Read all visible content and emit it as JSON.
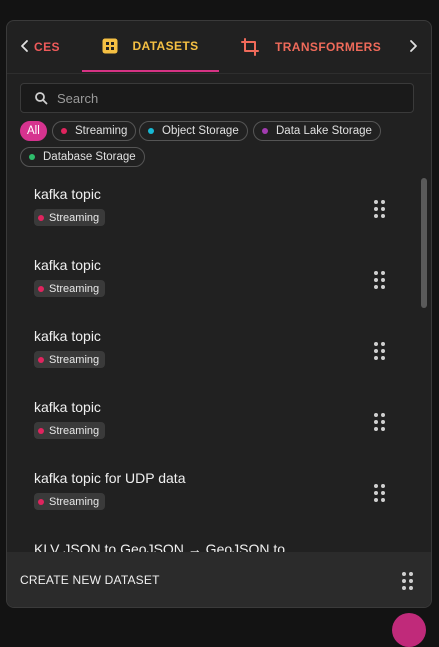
{
  "tabs": {
    "prev_label": "CES",
    "datasets_label": "DATASETS",
    "transformers_label": "TRANSFORMERS"
  },
  "search": {
    "placeholder": "Search"
  },
  "filters": [
    {
      "label": "All",
      "color": "#d6338f"
    },
    {
      "label": "Streaming",
      "color": "#e0245e"
    },
    {
      "label": "Object Storage",
      "color": "#17b8d4"
    },
    {
      "label": "Data Lake Storage",
      "color": "#a23bb0"
    },
    {
      "label": "Database Storage",
      "color": "#2ebd6b"
    }
  ],
  "datasets": [
    {
      "title": "kafka topic",
      "tag": "Streaming",
      "tag_color": "#e0245e"
    },
    {
      "title": "kafka topic",
      "tag": "Streaming",
      "tag_color": "#e0245e"
    },
    {
      "title": "kafka topic",
      "tag": "Streaming",
      "tag_color": "#e0245e"
    },
    {
      "title": "kafka topic",
      "tag": "Streaming",
      "tag_color": "#e0245e"
    },
    {
      "title": "kafka topic for UDP data",
      "tag": "Streaming",
      "tag_color": "#e0245e"
    },
    {
      "title": "KLV JSON to GeoJSON → GeoJSON to"
    }
  ],
  "footer": {
    "create_label": "CREATE NEW DATASET"
  },
  "icons": {
    "prev": "chevron-left-icon",
    "next": "chevron-right-icon",
    "datasets": "grid-icon",
    "transformers": "crop-icon",
    "search": "search-icon",
    "drag": "drag-handle-icon"
  },
  "colors": {
    "accent": "#d6338f",
    "datasets_tab": "#f5c043",
    "transformers_tab": "#ef6a5a"
  }
}
